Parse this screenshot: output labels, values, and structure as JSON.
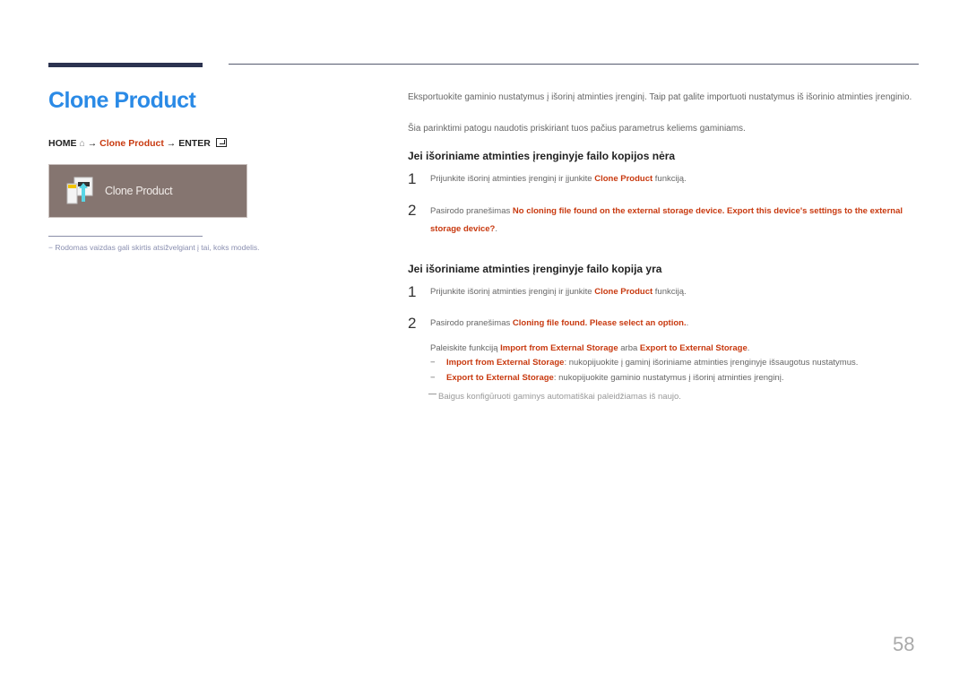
{
  "page": {
    "title": "Clone Product",
    "page_number": "58"
  },
  "breadcrumb": {
    "home": "HOME",
    "home_icon": "home-icon",
    "arrow1": "→",
    "item": "Clone Product",
    "arrow2": "→",
    "enter": "ENTER",
    "enter_icon": "enter-icon"
  },
  "menu_tile": {
    "label": "Clone Product",
    "icon": "clone-product-icon"
  },
  "note": "−  Rodomas vaizdas gali skirtis atsižvelgiant į tai, koks modelis.",
  "intro": {
    "p1": "Eksportuokite gaminio nustatymus į išorinį atminties įrenginį. Taip pat galite importuoti nustatymus iš išorinio atminties įrenginio.",
    "p2": "Šia parinktimi patogu naudotis priskiriant tuos pačius parametrus keliems gaminiams."
  },
  "section1": {
    "heading": "Jei išoriniame atminties įrenginyje failo kopijos nėra",
    "steps": [
      {
        "num": "1",
        "pre": "Prijunkite išorinį atminties įrenginį ir įjunkite ",
        "highlight": "Clone Product",
        "post": " funkciją."
      },
      {
        "num": "2",
        "pre": "Pasirodo pranešimas ",
        "highlight": "No cloning file found on the external storage device. Export this device's settings to the external storage device?",
        "post": "."
      }
    ]
  },
  "section2": {
    "heading": "Jei išoriniame atminties įrenginyje failo kopija yra",
    "steps": [
      {
        "num": "1",
        "pre": "Prijunkite išorinį atminties įrenginį ir įjunkite ",
        "highlight": "Clone Product",
        "post": " funkciją."
      },
      {
        "num": "2",
        "pre": "Pasirodo pranešimas ",
        "highlight": "Cloning file found. Please select an option.",
        "post": "."
      }
    ],
    "run_line": {
      "pre": "Paleiskite funkciją ",
      "opt1": "Import from External Storage",
      "mid": " arba ",
      "opt2": "Export to External Storage",
      "post": "."
    },
    "bullets": [
      {
        "dash": "−",
        "term": "Import from External Storage",
        "desc": ": nukopijuokite į gaminį išoriniame atminties įrenginyje išsaugotus nustatymus."
      },
      {
        "dash": "−",
        "term": "Export to External Storage",
        "desc": ": nukopijuokite gaminio nustatymus į išorinį atminties įrenginį."
      }
    ],
    "footnote": "Baigus konfigūruoti gaminys automatiškai paleidžiamas iš naujo."
  },
  "colors": {
    "title_blue": "#2a8ae6",
    "highlight_red": "#c8390f",
    "tile_bg": "#857570",
    "bar_dark": "#2c3350"
  }
}
